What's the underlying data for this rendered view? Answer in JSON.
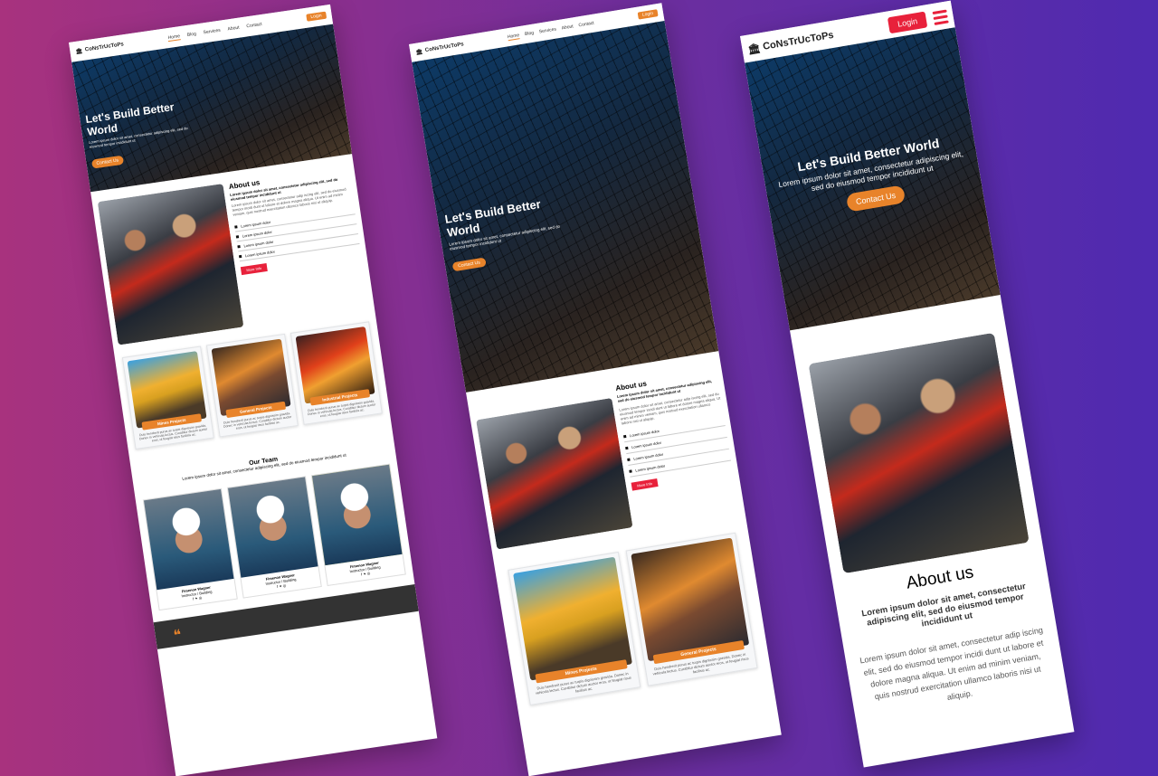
{
  "brand": "CoNsTrUcToPs",
  "nav": [
    "Home",
    "Blog",
    "Services",
    "About",
    "Contact"
  ],
  "login": "Login",
  "hero": {
    "title": "Let's Build Better World",
    "title_l1": "Let's Build Better",
    "title_l2": "World",
    "text": "Lorem ipsum dolor sit amet, consectetur adipiscing elit, sed do eiusmod tempor incididunt ut",
    "cta": "Contact Us"
  },
  "about": {
    "title": "About us",
    "lead": "Lorem ipsum dolor sit amet, consectetur adipiscing elit, sed do eiusmod tempor incididunt ut",
    "body": "Lorem ipsum dolor sit amet, consectetur adip iscing elit, sed do eiusmod tempor incidi dunt ut labore et dolore magna aliqua. Ut enim ad minim veniam, quis nostrud exercitation ullamco laboris nisi ut aliquip.",
    "list": [
      "Lorem ipsum dolor",
      "Lorem ipsum dolor",
      "Lorem ipsum dolor",
      "Lorem ipsum dolor"
    ],
    "more": "More Info"
  },
  "projects": [
    {
      "label": "Mines Projects"
    },
    {
      "label": "General Projects"
    },
    {
      "label": "Industrial Projects"
    }
  ],
  "project_text": "Duis hendrerit purus ac turpis dignissim gravida. Donec in vehicula lectus. Curabitur dictum auctor eros, ut feugiat risus facilisis ac.",
  "team": {
    "title": "Our Team",
    "text": "Lorem ipsum dolor sit amet, consectetur adipiscing elit, sed do eiusmod tempor incididunt ut",
    "members": [
      {
        "name": "Fimenon Wagner",
        "role": "Instructor / Building"
      },
      {
        "name": "Fimenon Wagner",
        "role": "Instructor / Building"
      },
      {
        "name": "Fimenon Wagner",
        "role": "Instructor / Building"
      }
    ],
    "social": "f ✦ ◎"
  },
  "quote_mark": "❝"
}
